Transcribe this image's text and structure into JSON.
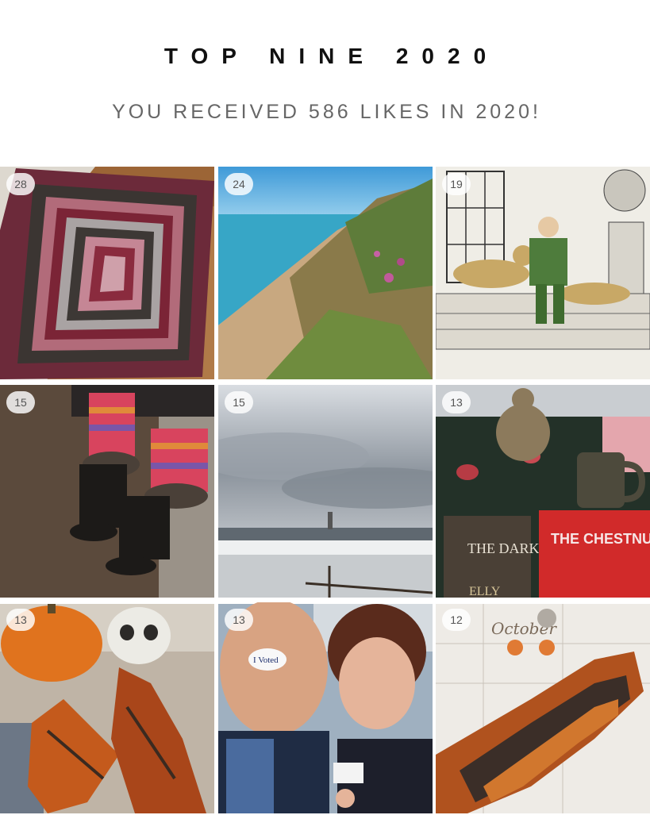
{
  "header": {
    "title": "TOP NINE 2020",
    "subtitle": "YOU RECEIVED 586 LIKES IN 2020!"
  },
  "tiles": [
    {
      "likes": "28",
      "subject": "knitted blanket"
    },
    {
      "likes": "24",
      "subject": "lake shore dune"
    },
    {
      "likes": "19",
      "subject": "illustration man with lions"
    },
    {
      "likes": "15",
      "subject": "striped legwarmers boots"
    },
    {
      "likes": "15",
      "subject": "winter lighthouse lake"
    },
    {
      "likes": "13",
      "subject": "cat mug books"
    },
    {
      "likes": "13",
      "subject": "pumpkin skull socks"
    },
    {
      "likes": "13",
      "subject": "voted selfie"
    },
    {
      "likes": "12",
      "subject": "planner knitted sock"
    }
  ],
  "photo_text": {
    "book_left": "THE DARK ANGEL",
    "book_left_author": "ELLY",
    "book_right": "THE CHESTNUT MAN",
    "sticker": "I Voted",
    "planner": "October"
  }
}
